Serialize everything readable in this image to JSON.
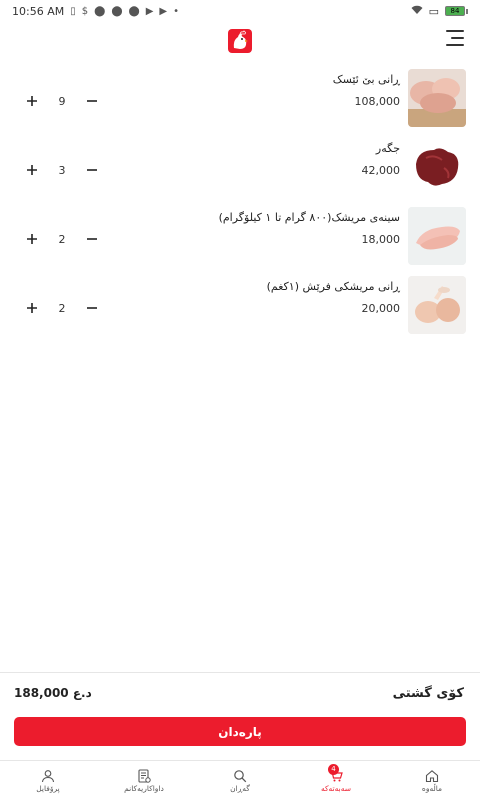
{
  "status_bar": {
    "time": "10:56 AM",
    "battery": "84"
  },
  "header": {
    "logo_icon": "rooster-logo-icon",
    "menu_icon": "menu-icon"
  },
  "cart": {
    "items": [
      {
        "name": "ڕانی بێ ئێسک",
        "price": "108,000",
        "quantity": "9"
      },
      {
        "name": "جگەر",
        "price": "42,000",
        "quantity": "3"
      },
      {
        "name": "سینەی مریشک(٨٠٠ گرام تا ١ کیلۆگرام)",
        "price": "18,000",
        "quantity": "2"
      },
      {
        "name": "ڕانی مریشکی فرێش (١کغم)",
        "price": "20,000",
        "quantity": "2"
      }
    ],
    "plus_icon": "plus-icon",
    "minus_icon": "minus-icon"
  },
  "summary": {
    "total_label": "کۆی گشتی",
    "total_value": "188,000 د.ع",
    "pay_button_label": "پارەدان"
  },
  "bottom_nav": {
    "items": [
      {
        "label": "پرۆفایل",
        "icon": "user-icon"
      },
      {
        "label": "داواکاریەکانم",
        "icon": "orders-icon"
      },
      {
        "label": "گەڕان",
        "icon": "search-icon"
      },
      {
        "label": "سەبەتەکە",
        "icon": "cart-icon",
        "badge": "4",
        "active": true
      },
      {
        "label": "ماڵەوە",
        "icon": "home-icon"
      }
    ]
  },
  "colors": {
    "accent": "#ec1c2d"
  }
}
